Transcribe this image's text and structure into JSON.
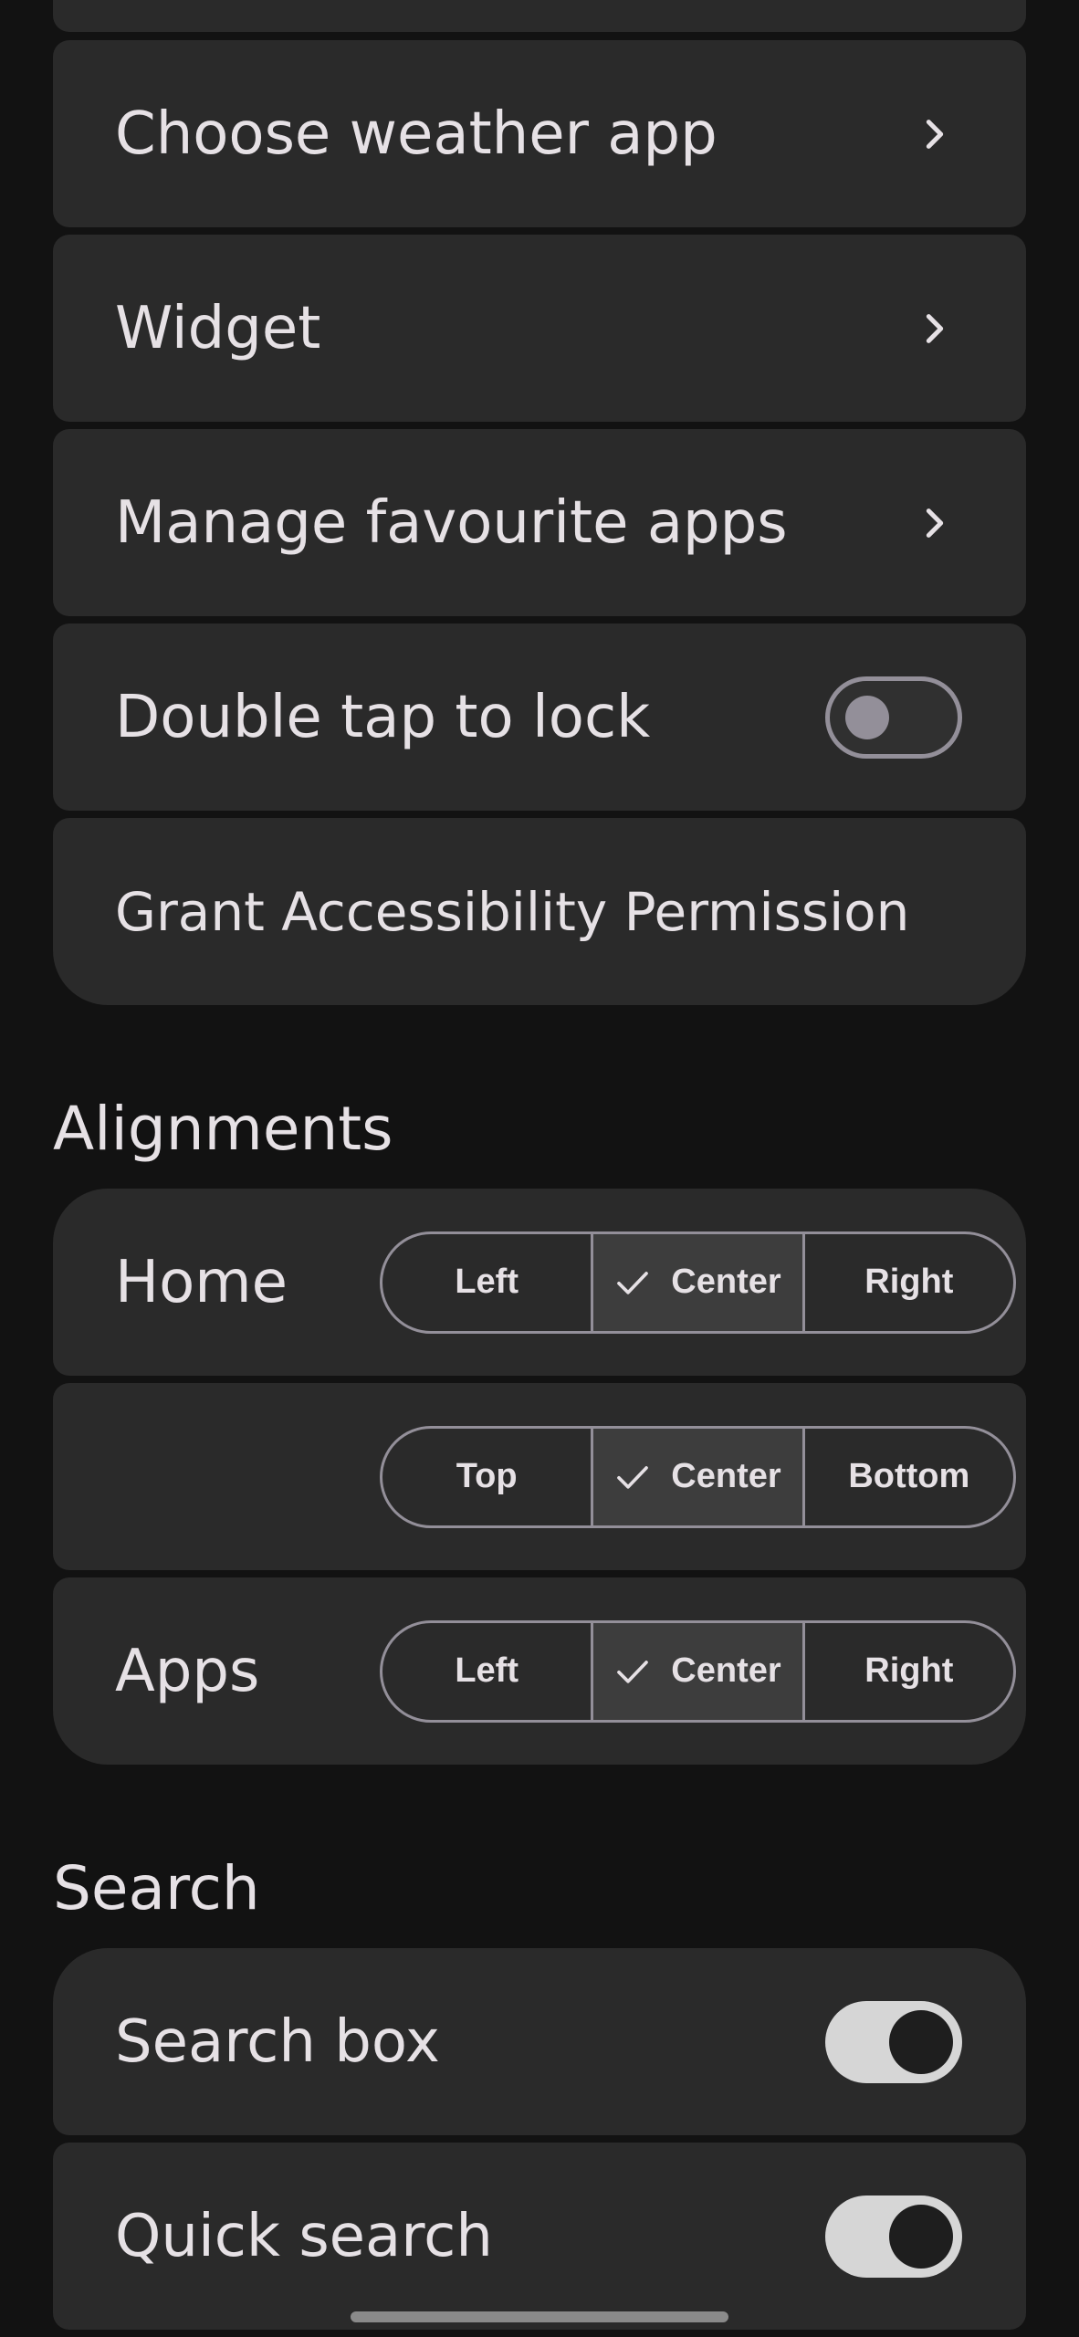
{
  "general": {
    "items": [
      {
        "label": "Choose weather app"
      },
      {
        "label": "Widget"
      },
      {
        "label": "Manage favourite apps"
      },
      {
        "label": "Double tap to lock",
        "toggle": false
      },
      {
        "label": "Grant Accessibility Permission"
      }
    ]
  },
  "alignments": {
    "title": "Alignments",
    "rows": [
      {
        "label": "Home",
        "options": [
          "Left",
          "Center",
          "Right"
        ],
        "selected": "Center"
      },
      {
        "label": "",
        "options": [
          "Top",
          "Center",
          "Bottom"
        ],
        "selected": "Center"
      },
      {
        "label": "Apps",
        "options": [
          "Left",
          "Center",
          "Right"
        ],
        "selected": "Center"
      }
    ]
  },
  "search": {
    "title": "Search",
    "items": [
      {
        "label": "Search box",
        "toggle": true
      },
      {
        "label": "Quick search",
        "toggle": true
      }
    ]
  },
  "colors": {
    "background": "#121212",
    "card": "#2a2a2a",
    "outline": "#938f99",
    "text": "#e6e1e5"
  }
}
